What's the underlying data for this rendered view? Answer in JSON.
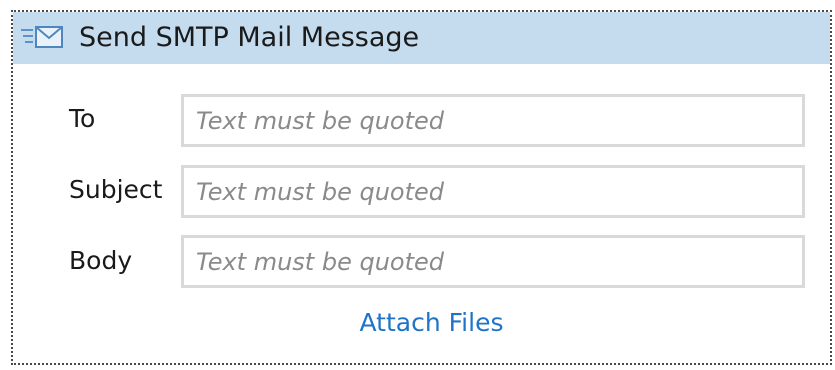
{
  "activity": {
    "title": "Send SMTP Mail Message",
    "icon": "envelope-icon"
  },
  "fields": [
    {
      "label": "To",
      "value": "",
      "placeholder": "Text must be quoted"
    },
    {
      "label": "Subject",
      "value": "",
      "placeholder": "Text must be quoted"
    },
    {
      "label": "Body",
      "value": "",
      "placeholder": "Text must be quoted"
    }
  ],
  "attach_label": "Attach Files",
  "colors": {
    "header_background": "#c5dcef",
    "link": "#1f73c8",
    "input_border": "#d9d9d9"
  }
}
